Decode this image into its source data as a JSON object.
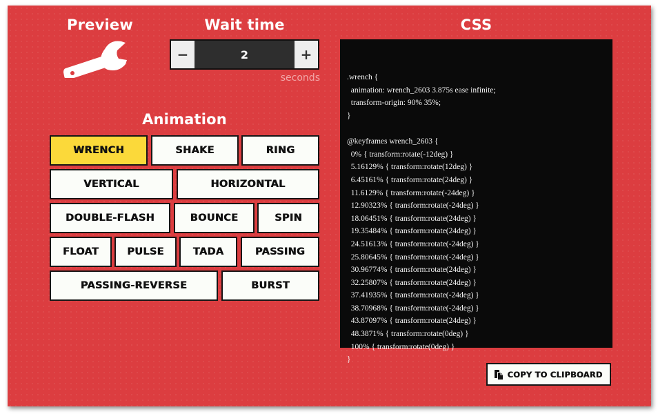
{
  "preview": {
    "heading": "Preview",
    "icon": "wrench-icon"
  },
  "wait_time": {
    "heading": "Wait time",
    "decrement_label": "−",
    "increment_label": "+",
    "value": "2",
    "unit": "seconds"
  },
  "animation": {
    "heading": "Animation",
    "selected": "WRENCH",
    "options": [
      "WRENCH",
      "SHAKE",
      "RING",
      "VERTICAL",
      "HORIZONTAL",
      "DOUBLE-FLASH",
      "BOUNCE",
      "SPIN",
      "FLOAT",
      "PULSE",
      "TADA",
      "PASSING",
      "PASSING-REVERSE",
      "BURST"
    ]
  },
  "css": {
    "heading": "CSS",
    "code_lines": [
      ".wrench {",
      "  animation: wrench_2603 3.875s ease infinite;",
      "  transform-origin: 90% 35%;",
      "}",
      "",
      "@keyframes wrench_2603 {",
      "  0% { transform:rotate(-12deg) }",
      "  5.16129% { transform:rotate(12deg) }",
      "  6.45161% { transform:rotate(24deg) }",
      "  11.6129% { transform:rotate(-24deg) }",
      "  12.90323% { transform:rotate(-24deg) }",
      "  18.06451% { transform:rotate(24deg) }",
      "  19.35484% { transform:rotate(24deg) }",
      "  24.51613% { transform:rotate(-24deg) }",
      "  25.80645% { transform:rotate(-24deg) }",
      "  30.96774% { transform:rotate(24deg) }",
      "  32.25807% { transform:rotate(24deg) }",
      "  37.41935% { transform:rotate(-24deg) }",
      "  38.70968% { transform:rotate(-24deg) }",
      "  43.87097% { transform:rotate(24deg) }",
      "  48.3871% { transform:rotate(0deg) }",
      "  100% { transform:rotate(0deg) }",
      "}"
    ],
    "copy_button_label": "COPY TO CLIPBOARD",
    "copy_icon": "clipboard-copy-icon"
  },
  "colors": {
    "background": "#dc3d40",
    "selected_button": "#fbd93a",
    "button": "#fbfdf9",
    "code_background": "#0a0a0a"
  }
}
